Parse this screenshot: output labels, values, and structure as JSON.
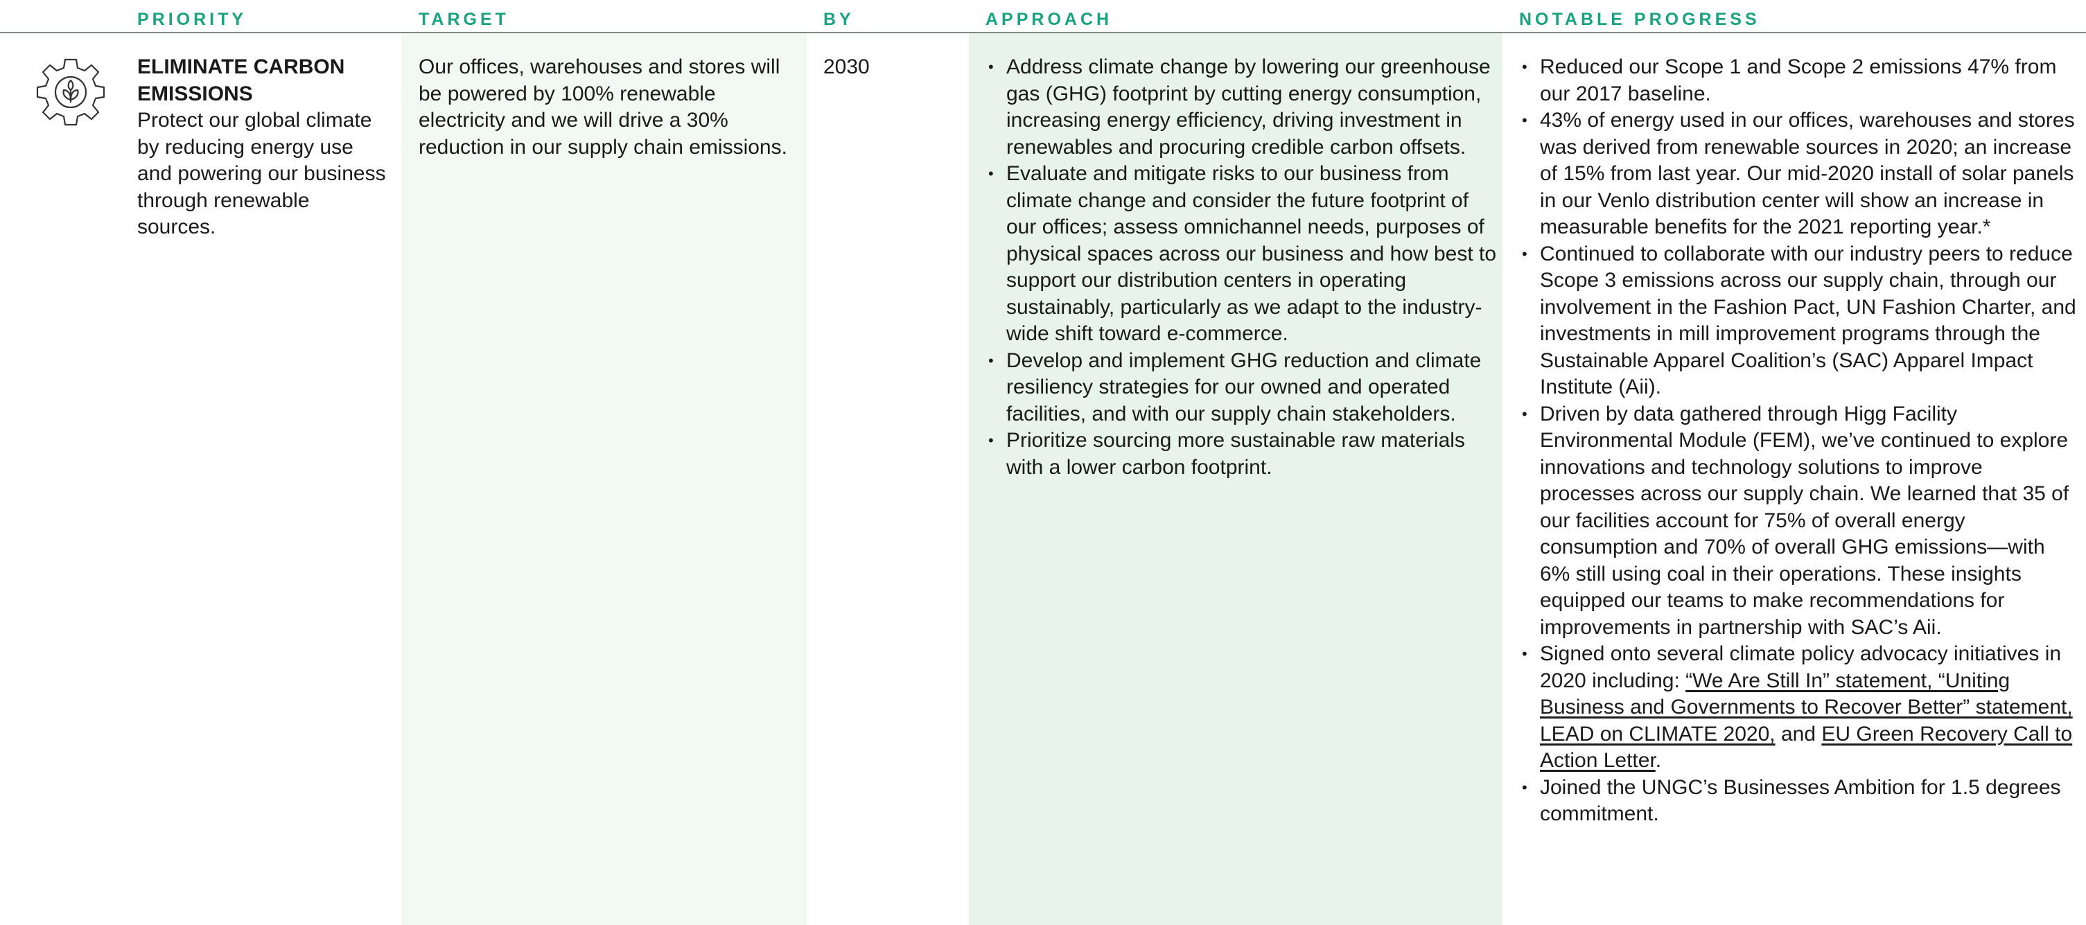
{
  "headers": {
    "priority": "PRIORITY",
    "target": "TARGET",
    "by": "BY",
    "approach": "APPROACH",
    "progress": "NOTABLE PROGRESS"
  },
  "icon": "gear-leaf-icon",
  "accent_color": "#1aa37f",
  "row": {
    "priority_title": "ELIMINATE CARBON EMISSIONS",
    "priority_desc": "Protect our global climate by reducing energy use and powering our business through renewable sources.",
    "target": "Our offices, warehouses and stores will be powered by 100% renewable electricity and we will drive a 30% reduction in our supply chain emissions.",
    "by": "2030",
    "approach": [
      "Address climate change by lowering our greenhouse gas (GHG) footprint by cutting energy consumption, increasing energy efficiency, driving investment in renewables and procuring credible carbon offsets.",
      "Evaluate and mitigate risks to our business from climate change and consider the future footprint of our offices; assess omnichannel needs, purposes of physical spaces across our business and how best to support our distribution centers in operating sustainably, particularly as we adapt to the industry-wide shift toward e-commerce.",
      "Develop and implement GHG reduction and climate resiliency strategies for our owned and operated facilities, and with our supply chain stakeholders.",
      "Prioritize sourcing more sustainable raw materials with a lower carbon footprint."
    ],
    "progress": [
      "Reduced our Scope 1 and Scope 2 emissions 47% from our 2017 baseline.",
      "43% of energy used in our offices, warehouses and stores was derived from renewable sources in 2020; an increase of 15% from last year. Our mid-2020 install of solar panels in our Venlo distribution center will show an increase in measurable benefits for the 2021 reporting year.*",
      "Continued to collaborate with our industry peers to reduce Scope 3 emissions across our supply chain, through our involvement in the Fashion Pact, UN Fashion Charter, and investments in mill improvement programs through the Sustainable Apparel Coalition’s (SAC) Apparel Impact Institute (Aii).",
      "Driven by data gathered through Higg Facility Environmental Module (FEM), we’ve continued to explore innovations and technology solutions to improve processes across our supply chain. We learned that 35 of our facilities account for 75% of overall energy consumption and 70% of overall GHG emissions—with 6% still using coal in their operations. These insights equipped our teams to make recommendations for improvements in partnership with SAC’s Aii."
    ],
    "advocacy": {
      "prefix": "Signed onto several climate policy advocacy initiatives in 2020 including: ",
      "link1": "“We Are Still In” statement, ",
      "link2": "“Uniting Business and Governments to Recover Better” statement, ",
      "link3": "LEAD on CLIMATE 2020,",
      "mid": " and ",
      "link4": "EU Green Recovery Call to Action Letter",
      "suffix": "."
    },
    "last_progress": "Joined the UNGC’s Businesses Ambition for 1.5 degrees commitment."
  }
}
